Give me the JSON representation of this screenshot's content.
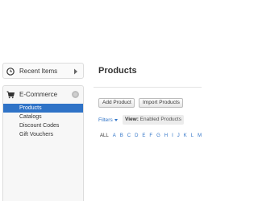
{
  "sidebar": {
    "recent": {
      "label": "Recent Items",
      "icon": "clock-icon"
    },
    "ecommerce": {
      "label": "E-Commerce",
      "icon": "shopping-cart-icon",
      "items": [
        {
          "label": "Products",
          "active": true
        },
        {
          "label": "Catalogs",
          "active": false
        },
        {
          "label": "Discount Codes",
          "active": false
        },
        {
          "label": "Gift Vouchers",
          "active": false
        }
      ]
    }
  },
  "main": {
    "title": "Products",
    "buttons": {
      "add": "Add Product",
      "import": "Import Products"
    },
    "filters_label": "Filters",
    "view": {
      "label": "View:",
      "value": "Enabled Products"
    },
    "alpha": [
      "ALL",
      "A",
      "B",
      "C",
      "D",
      "E",
      "F",
      "G",
      "H",
      "I",
      "J",
      "K",
      "L",
      "M"
    ]
  },
  "colors": {
    "accent": "#2f73c7",
    "active_item_text": "#ffffff"
  }
}
